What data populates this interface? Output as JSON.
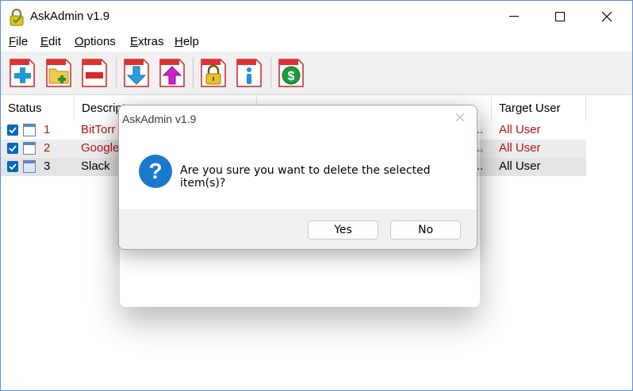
{
  "window": {
    "title": "AskAdmin v1.9"
  },
  "menu": [
    {
      "key": "F",
      "rest": "ile"
    },
    {
      "key": "E",
      "rest": "dit"
    },
    {
      "key": "O",
      "rest": "ptions"
    },
    {
      "key": "E",
      "rest": "xtras"
    },
    {
      "key": "H",
      "rest": "elp"
    }
  ],
  "toolbar": {
    "buttons": [
      "add",
      "add-folder",
      "remove",
      "import",
      "export",
      "lock",
      "info",
      "donate"
    ]
  },
  "list": {
    "columns": [
      "Status",
      "Descript",
      "",
      "Target User"
    ],
    "rows": [
      {
        "num": "1",
        "desc": "BitTorr",
        "path_tail": "..",
        "target": "All User",
        "checked": true,
        "highlight": "red"
      },
      {
        "num": "2",
        "desc": "Google",
        "path_tail": "..",
        "target": "All User",
        "checked": true,
        "highlight": "red"
      },
      {
        "num": "3",
        "desc": "Slack",
        "path_tail": "..",
        "target": "All User",
        "checked": true,
        "highlight": "none"
      }
    ]
  },
  "dialog": {
    "title": "AskAdmin v1.9",
    "message": "Are you sure you want to delete the selected item(s)?",
    "yes_label": "Yes",
    "no_label": "No"
  },
  "colors": {
    "accent": "#0067c0",
    "red_text": "#b3121a",
    "question_icon": "#1a78cf"
  }
}
